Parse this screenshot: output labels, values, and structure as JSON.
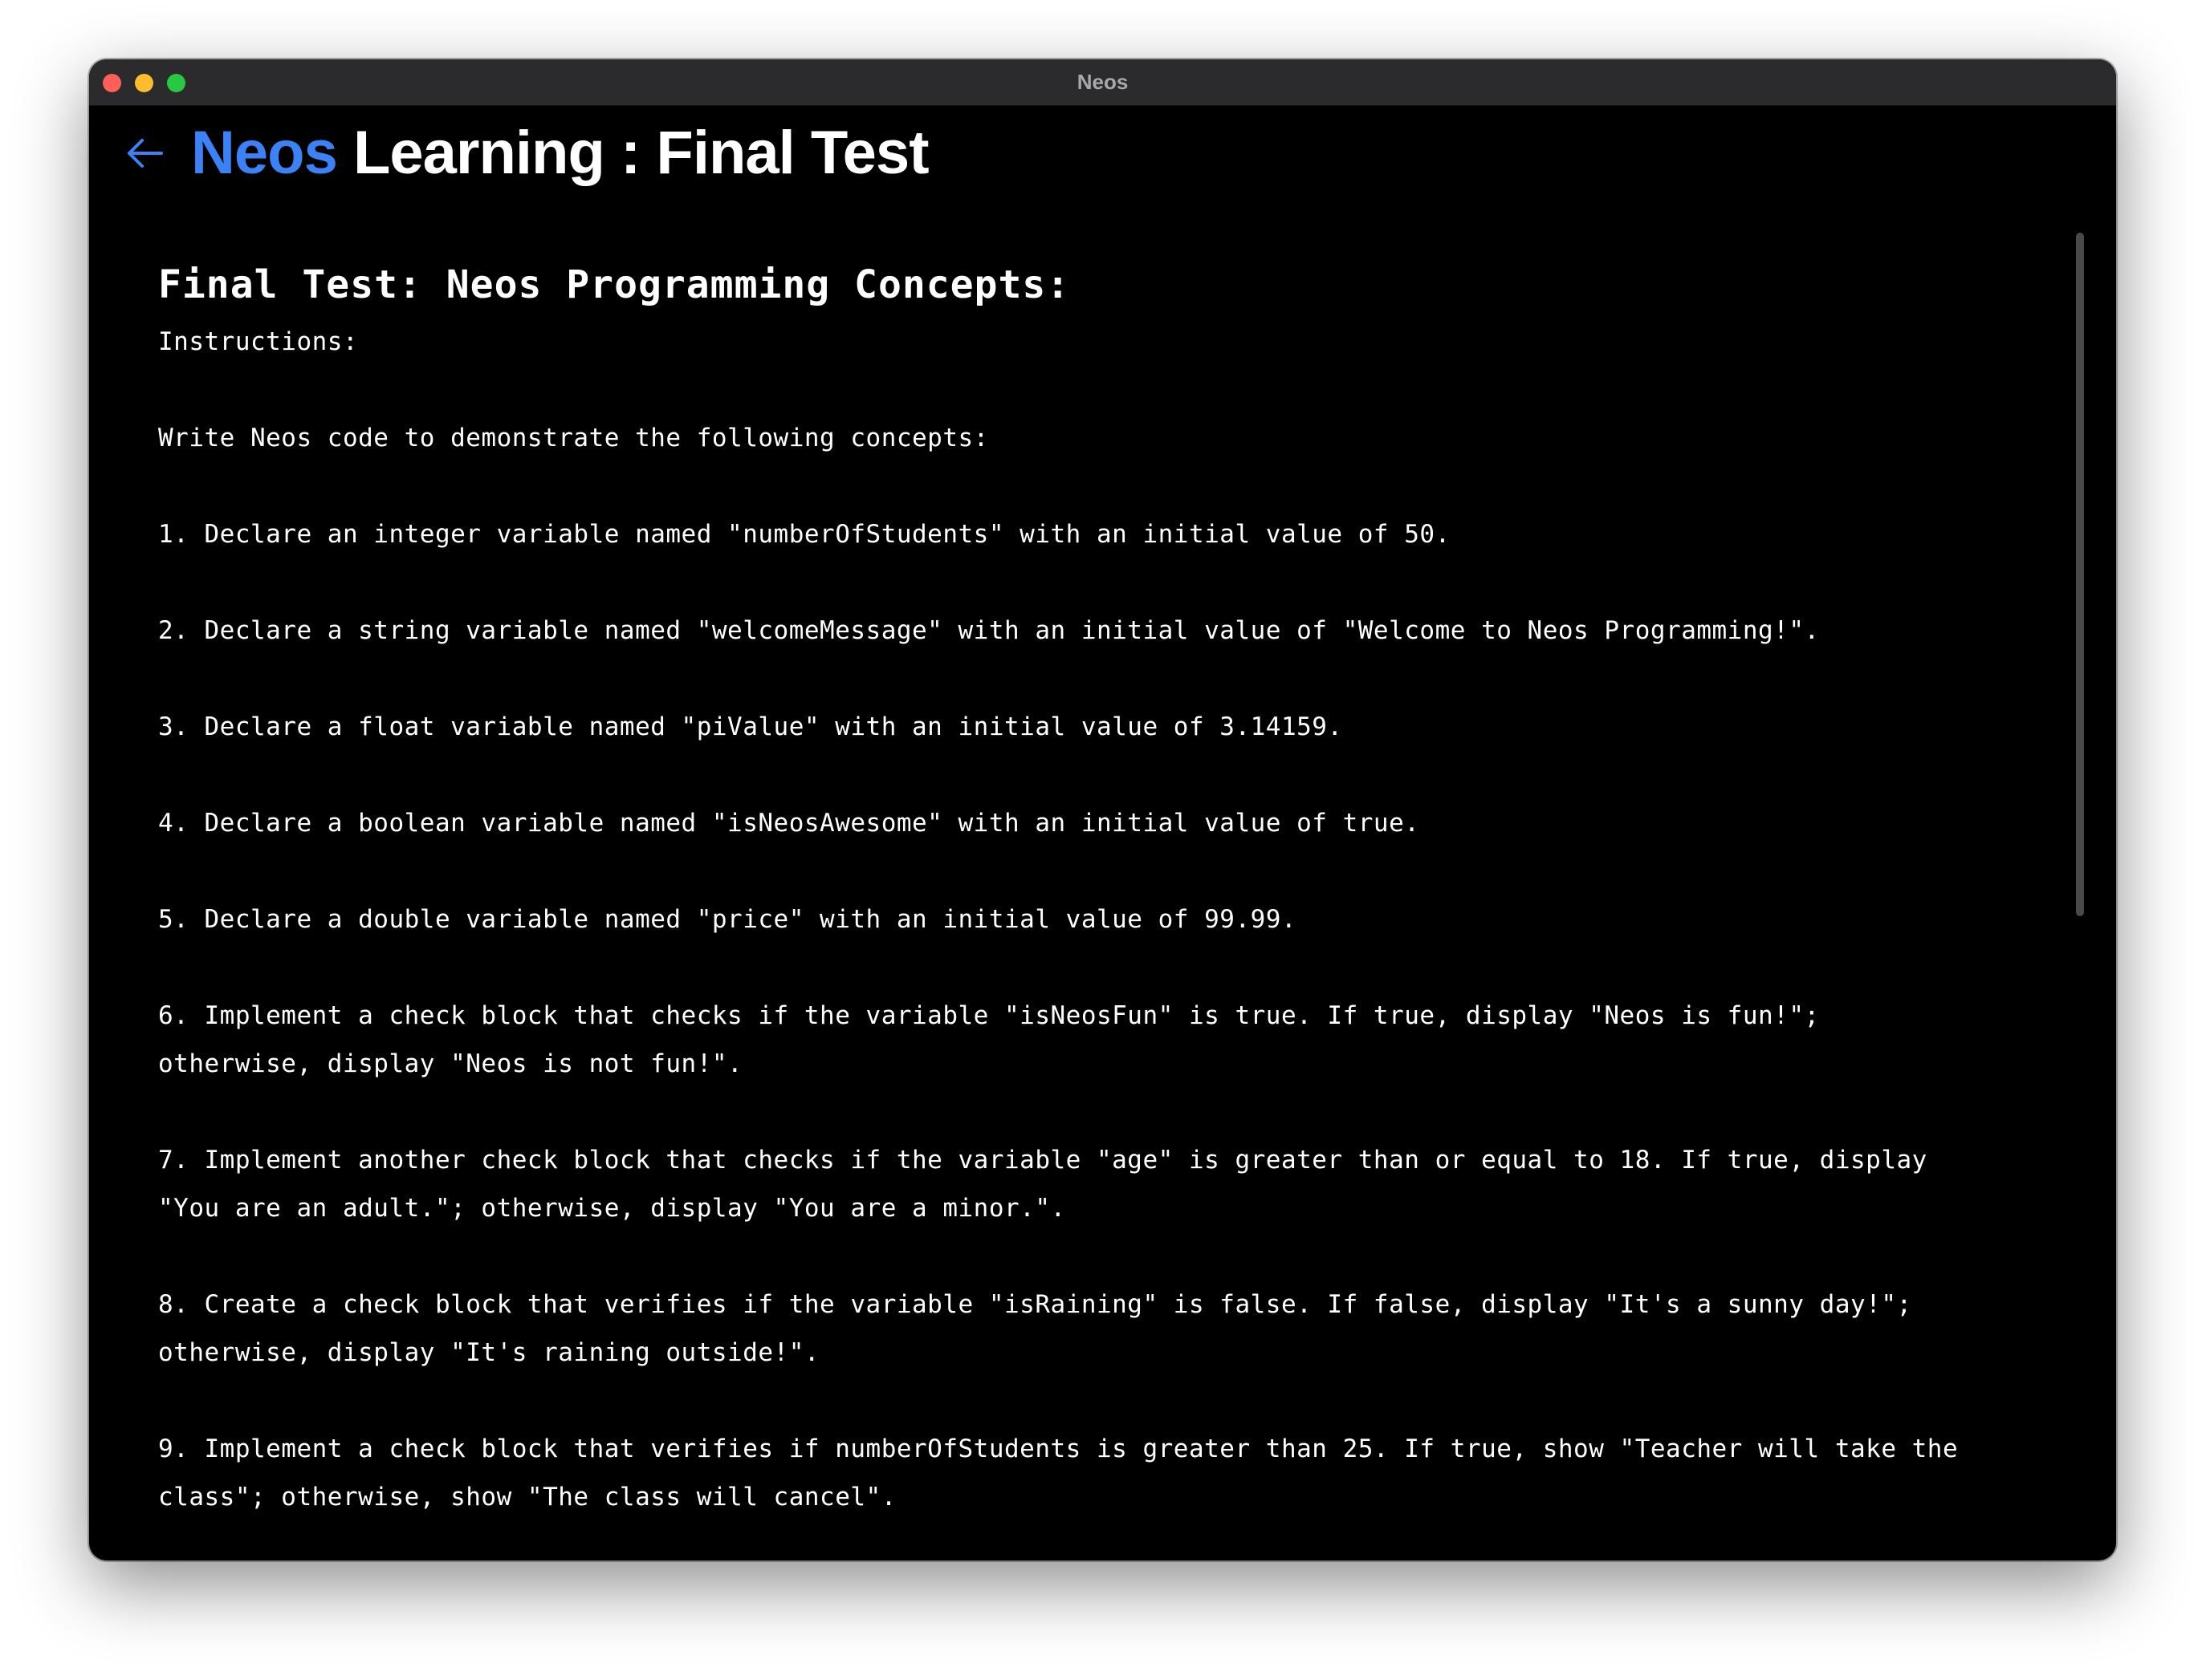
{
  "window": {
    "title": "Neos"
  },
  "header": {
    "brand": "Neos",
    "title_rest": " Learning : Final Test"
  },
  "content": {
    "heading": "Final Test: Neos Programming Concepts:",
    "paragraphs": [
      "Instructions:",
      "Write Neos code to demonstrate the following concepts:",
      "1. Declare an integer variable named \"numberOfStudents\" with an initial value of 50.",
      "2. Declare a string variable named \"welcomeMessage\" with an initial value of \"Welcome to Neos Programming!\".",
      "3. Declare a float variable named \"piValue\" with an initial value of 3.14159.",
      "4. Declare a boolean variable named \"isNeosAwesome\" with an initial value of true.",
      "5. Declare a double variable named \"price\" with an initial value of 99.99.",
      "6. Implement a check block that checks if the variable \"isNeosFun\" is true. If true, display \"Neos is fun!\";\notherwise, display \"Neos is not fun!\".",
      "7. Implement another check block that checks if the variable \"age\" is greater than or equal to 18. If true, display\n\"You are an adult.\"; otherwise, display \"You are a minor.\".",
      "8. Create a check block that verifies if the variable \"isRaining\" is false. If false, display \"It's a sunny day!\";\notherwise, display \"It's raining outside!\".",
      "9. Implement a check block that verifies if numberOfStudents is greater than 25. If true, show \"Teacher will take the\nclass\"; otherwise, show \"The class will cancel\"."
    ]
  },
  "icons": {
    "back": "arrow-left-icon"
  },
  "colors": {
    "accent": "#3b82f6",
    "background": "#000000",
    "titlebar": "#2b2b2d"
  }
}
